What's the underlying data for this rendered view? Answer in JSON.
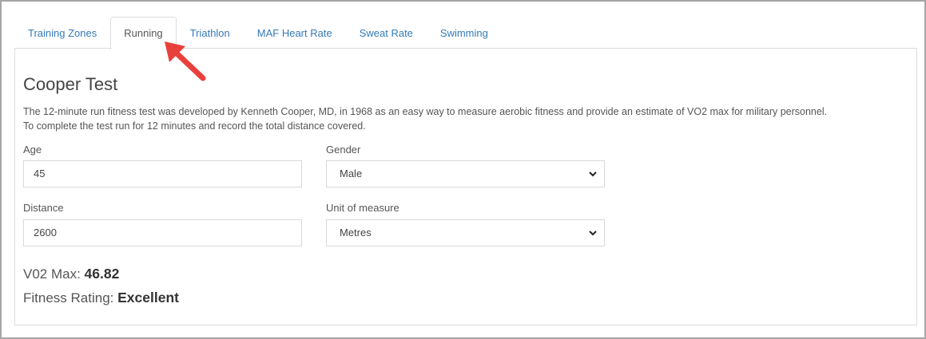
{
  "tabs": [
    {
      "label": "Training Zones",
      "active": false
    },
    {
      "label": "Running",
      "active": true
    },
    {
      "label": "Triathlon",
      "active": false
    },
    {
      "label": "MAF Heart Rate",
      "active": false
    },
    {
      "label": "Sweat Rate",
      "active": false
    },
    {
      "label": "Swimming",
      "active": false
    }
  ],
  "panel": {
    "title": "Cooper Test",
    "description_line1": "The 12-minute run fitness test was developed by Kenneth Cooper, MD, in 1968 as an easy way to measure aerobic fitness and provide an estimate of VO2 max for military personnel.",
    "description_line2": "To complete the test run for 12 minutes and record the total distance covered."
  },
  "form": {
    "age": {
      "label": "Age",
      "value": "45"
    },
    "gender": {
      "label": "Gender",
      "value": "Male"
    },
    "distance": {
      "label": "Distance",
      "value": "2600"
    },
    "unit": {
      "label": "Unit of measure",
      "value": "Metres"
    }
  },
  "results": {
    "vo2_label": "V02 Max:",
    "vo2_value": "46.82",
    "rating_label": "Fitness Rating:",
    "rating_value": "Excellent"
  },
  "colors": {
    "link": "#337ab7",
    "annotation_arrow": "#e8413c"
  },
  "icons": {
    "select_chevron": "chevron-down-icon",
    "annotation": "red-arrow-annotation"
  }
}
